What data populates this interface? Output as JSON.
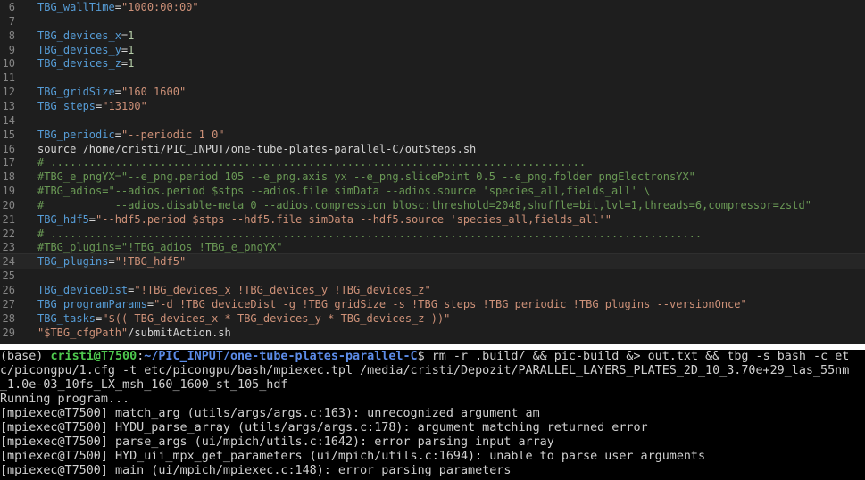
{
  "editor": {
    "lines": [
      {
        "n": "6",
        "tokens": [
          [
            "var",
            "TBG_wallTime"
          ],
          [
            "plain",
            "="
          ],
          [
            "str",
            "\"1000:00:00\""
          ]
        ]
      },
      {
        "n": "7",
        "tokens": []
      },
      {
        "n": "8",
        "tokens": [
          [
            "var",
            "TBG_devices_x"
          ],
          [
            "plain",
            "="
          ],
          [
            "num",
            "1"
          ]
        ]
      },
      {
        "n": "9",
        "tokens": [
          [
            "var",
            "TBG_devices_y"
          ],
          [
            "plain",
            "="
          ],
          [
            "num",
            "1"
          ]
        ]
      },
      {
        "n": "10",
        "tokens": [
          [
            "var",
            "TBG_devices_z"
          ],
          [
            "plain",
            "="
          ],
          [
            "num",
            "1"
          ]
        ]
      },
      {
        "n": "11",
        "tokens": []
      },
      {
        "n": "12",
        "tokens": [
          [
            "var",
            "TBG_gridSize"
          ],
          [
            "plain",
            "="
          ],
          [
            "str",
            "\"160 1600\""
          ]
        ]
      },
      {
        "n": "13",
        "tokens": [
          [
            "var",
            "TBG_steps"
          ],
          [
            "plain",
            "="
          ],
          [
            "str",
            "\"13100\""
          ]
        ]
      },
      {
        "n": "14",
        "tokens": []
      },
      {
        "n": "15",
        "tokens": [
          [
            "var",
            "TBG_periodic"
          ],
          [
            "plain",
            "="
          ],
          [
            "str",
            "\"--periodic 1 0\""
          ]
        ]
      },
      {
        "n": "16",
        "tokens": [
          [
            "plain",
            "source /home/cristi/PIC_INPUT/one-tube-plates-parallel-C/outSteps.sh"
          ]
        ]
      },
      {
        "n": "17",
        "tokens": [
          [
            "cmt",
            "# ..................................................................................."
          ]
        ]
      },
      {
        "n": "18",
        "tokens": [
          [
            "cmt",
            "#TBG_e_pngYX=\"--e_png.period 105 --e_png.axis yx --e_png.slicePoint 0.5 --e_png.folder pngElectronsYX\""
          ]
        ]
      },
      {
        "n": "19",
        "tokens": [
          [
            "cmt",
            "#TBG_adios=\"--adios.period $stps --adios.file simData --adios.source 'species_all,fields_all' \\"
          ]
        ]
      },
      {
        "n": "20",
        "tokens": [
          [
            "cmt",
            "#           --adios.disable-meta 0 --adios.compression blosc:threshold=2048,shuffle=bit,lvl=1,threads=6,compressor=zstd\""
          ]
        ]
      },
      {
        "n": "21",
        "tokens": [
          [
            "var",
            "TBG_hdf5"
          ],
          [
            "plain",
            "="
          ],
          [
            "str",
            "\"--hdf5.period $stps --hdf5.file simData --hdf5.source 'species_all,fields_all'\""
          ]
        ]
      },
      {
        "n": "22",
        "tokens": [
          [
            "cmt",
            "# ....................................................................................................."
          ]
        ]
      },
      {
        "n": "23",
        "tokens": [
          [
            "cmt",
            "#TBG_plugins=\"!TBG_adios !TBG_e_pngYX\""
          ]
        ]
      },
      {
        "n": "24",
        "tokens": [
          [
            "var",
            "TBG_plugins"
          ],
          [
            "plain",
            "="
          ],
          [
            "str",
            "\"!TBG_hdf5\""
          ]
        ],
        "current": true
      },
      {
        "n": "25",
        "tokens": []
      },
      {
        "n": "26",
        "tokens": [
          [
            "var",
            "TBG_deviceDist"
          ],
          [
            "plain",
            "="
          ],
          [
            "str",
            "\"!TBG_devices_x !TBG_devices_y !TBG_devices_z\""
          ]
        ]
      },
      {
        "n": "27",
        "tokens": [
          [
            "var",
            "TBG_programParams"
          ],
          [
            "plain",
            "="
          ],
          [
            "str",
            "\"-d !TBG_deviceDist -g !TBG_gridSize -s !TBG_steps !TBG_periodic !TBG_plugins --versionOnce\""
          ]
        ]
      },
      {
        "n": "28",
        "tokens": [
          [
            "var",
            "TBG_tasks"
          ],
          [
            "plain",
            "="
          ],
          [
            "str",
            "\"$(( TBG_devices_x * TBG_devices_y * TBG_devices_z ))\""
          ]
        ]
      },
      {
        "n": "29",
        "tokens": [
          [
            "str",
            "\"$TBG_cfgPath\""
          ],
          [
            "plain",
            "/submitAction.sh"
          ]
        ]
      }
    ]
  },
  "terminal": {
    "prompt": {
      "env": "(base) ",
      "user_host": "cristi@T7500",
      "sep": ":",
      "path": "~/PIC_INPUT/one-tube-plates-parallel-C",
      "symbol": "$ "
    },
    "command_first": "rm -r .build/ && pic-build &> out.txt && tbg -s bash -c et",
    "command_continuation": [
      "c/picongpu/1.cfg -t etc/picongpu/bash/mpiexec.tpl /media/cristi/Depozit/PARALLEL_LAYERS_PLATES_2D_10_3.70e+29_las_55nm",
      "_1.0e-03_10fs_LX_msh_160_1600_st_105_hdf"
    ],
    "output": [
      "Running program...",
      "[mpiexec@T7500] match_arg (utils/args/args.c:163): unrecognized argument am",
      "[mpiexec@T7500] HYDU_parse_array (utils/args/args.c:178): argument matching returned error",
      "[mpiexec@T7500] parse_args (ui/mpich/utils.c:1642): error parsing input array",
      "[mpiexec@T7500] HYD_uii_mpx_get_parameters (ui/mpich/utils.c:1694): unable to parse user arguments",
      "[mpiexec@T7500] main (ui/mpich/mpiexec.c:148): error parsing parameters"
    ]
  }
}
